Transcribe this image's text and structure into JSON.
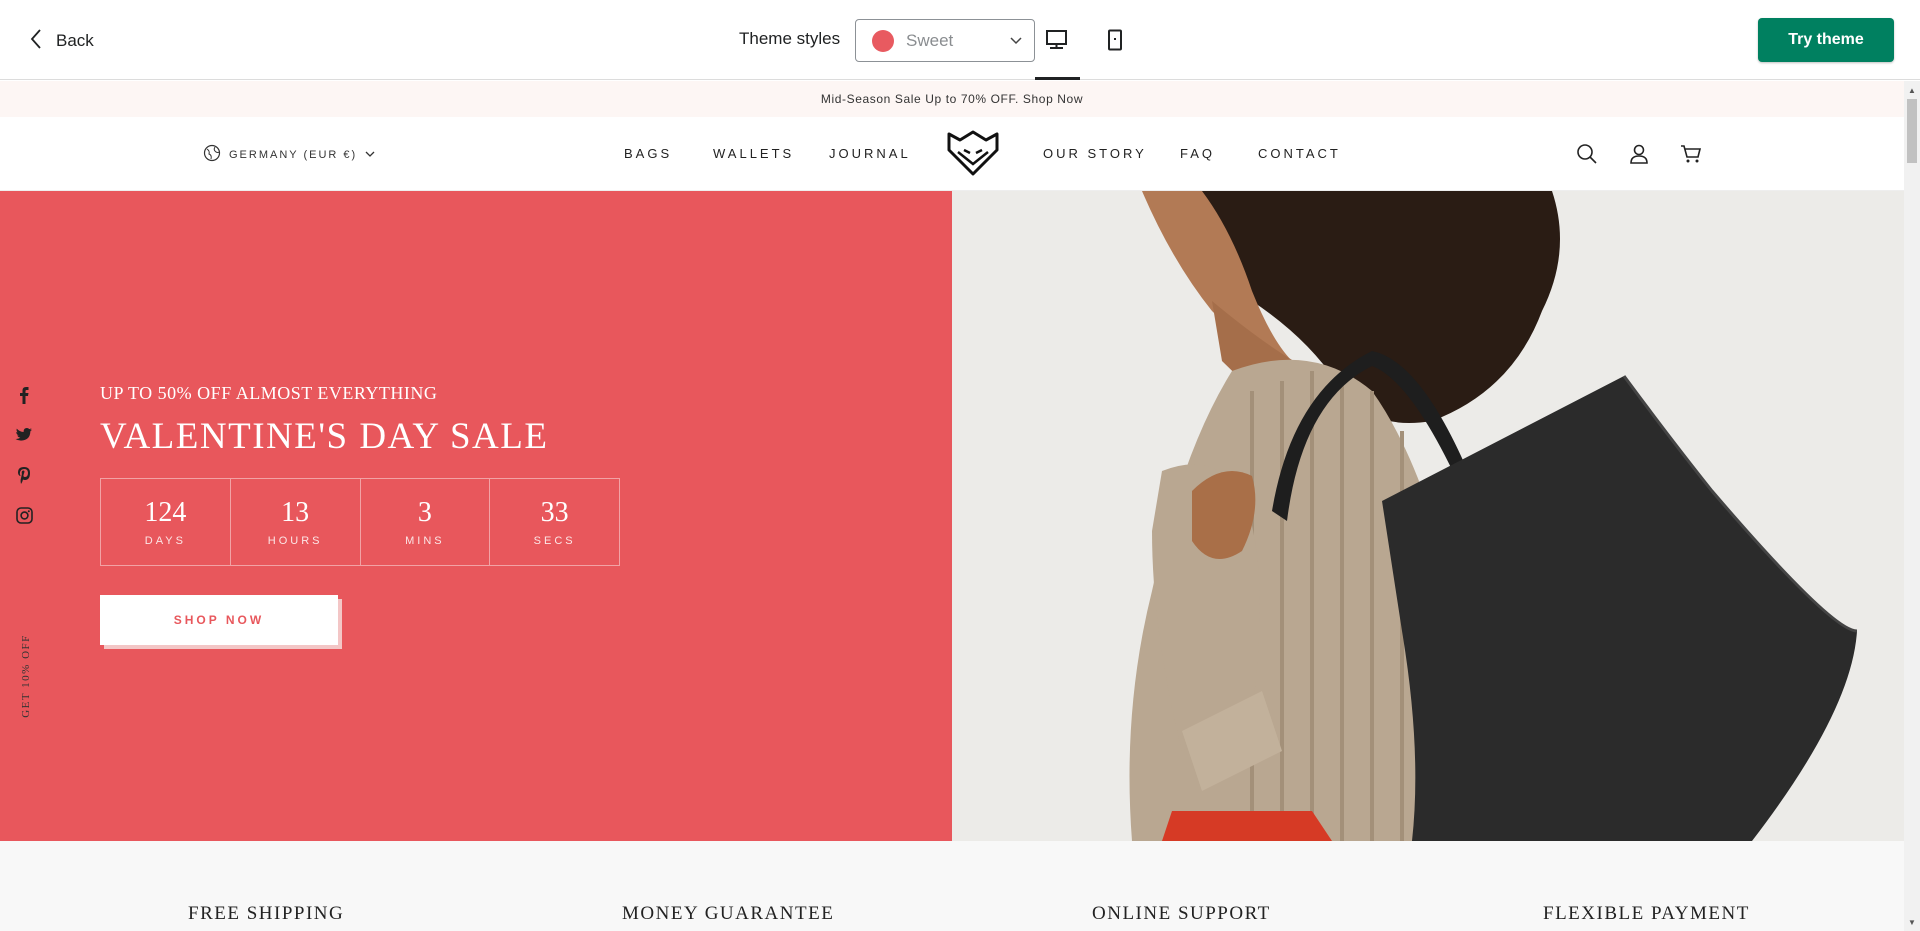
{
  "topbar": {
    "back_label": "Back",
    "theme_styles_label": "Theme styles",
    "theme_value": "Sweet",
    "theme_color": "#e85a60",
    "try_theme_label": "Try theme",
    "try_theme_color": "#008060",
    "devices": [
      "desktop-icon",
      "mobile-icon"
    ],
    "active_device": "desktop"
  },
  "store": {
    "announcement": "Mid-Season Sale Up to 70% OFF. Shop Now",
    "country": "GERMANY (EUR €)",
    "nav_left": [
      "BAGS",
      "WALLETS",
      "JOURNAL"
    ],
    "nav_right": [
      "OUR STORY",
      "FAQ",
      "CONTACT"
    ],
    "header_icons": [
      "search-icon",
      "account-icon",
      "cart-icon"
    ],
    "brand_color": "#e8575c"
  },
  "hero": {
    "subtitle": "UP TO 50% OFF ALMOST EVERYTHING",
    "title": "VALENTINE'S DAY SALE",
    "countdown": [
      {
        "value": "124",
        "label": "DAYS"
      },
      {
        "value": "13",
        "label": "HOURS"
      },
      {
        "value": "3",
        "label": "MINS"
      },
      {
        "value": "33",
        "label": "SECS"
      }
    ],
    "cta": "SHOP NOW"
  },
  "social": [
    "facebook-icon",
    "twitter-icon",
    "pinterest-icon",
    "instagram-icon"
  ],
  "side_promo": "GET 10% OFF",
  "features": [
    "FREE SHIPPING",
    "MONEY GUARANTEE",
    "ONLINE SUPPORT",
    "FLEXIBLE PAYMENT"
  ]
}
